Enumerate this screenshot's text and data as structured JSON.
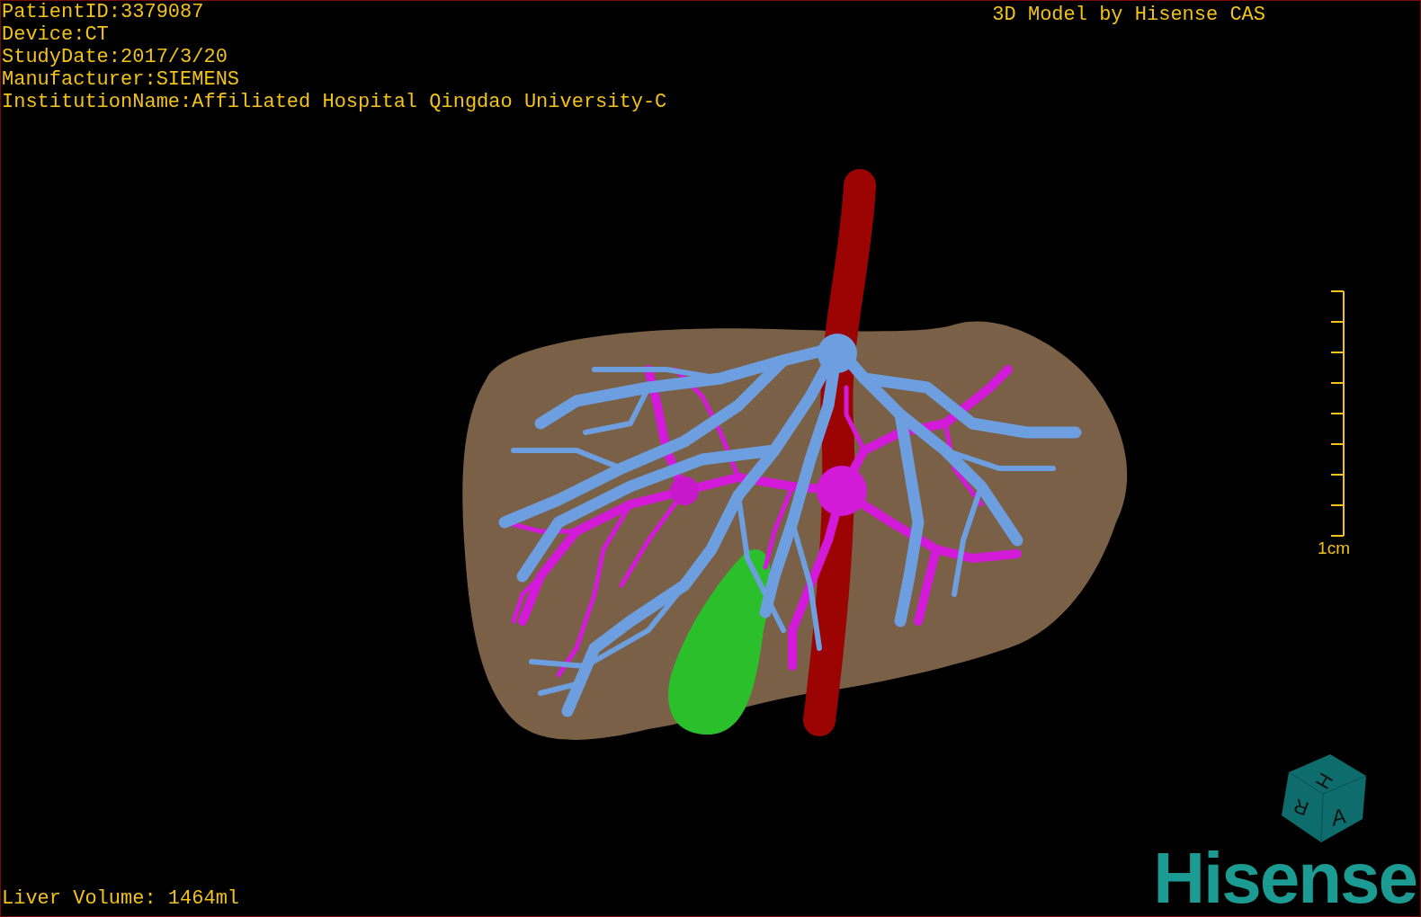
{
  "info_lines": [
    "PatientID:3379087",
    "Device:CT",
    "StudyDate:2017/3/20",
    "Manufacturer:SIEMENS",
    "InstitutionName:Affiliated Hospital Qingdao University-C"
  ],
  "title": "3D Model by Hisense CAS",
  "scale_bar": {
    "label": "1cm"
  },
  "orientation_cube": {
    "labels": [
      "H",
      "R",
      "A"
    ]
  },
  "liver_volume": "Liver Volume: 1464ml",
  "logo": "Hisense"
}
